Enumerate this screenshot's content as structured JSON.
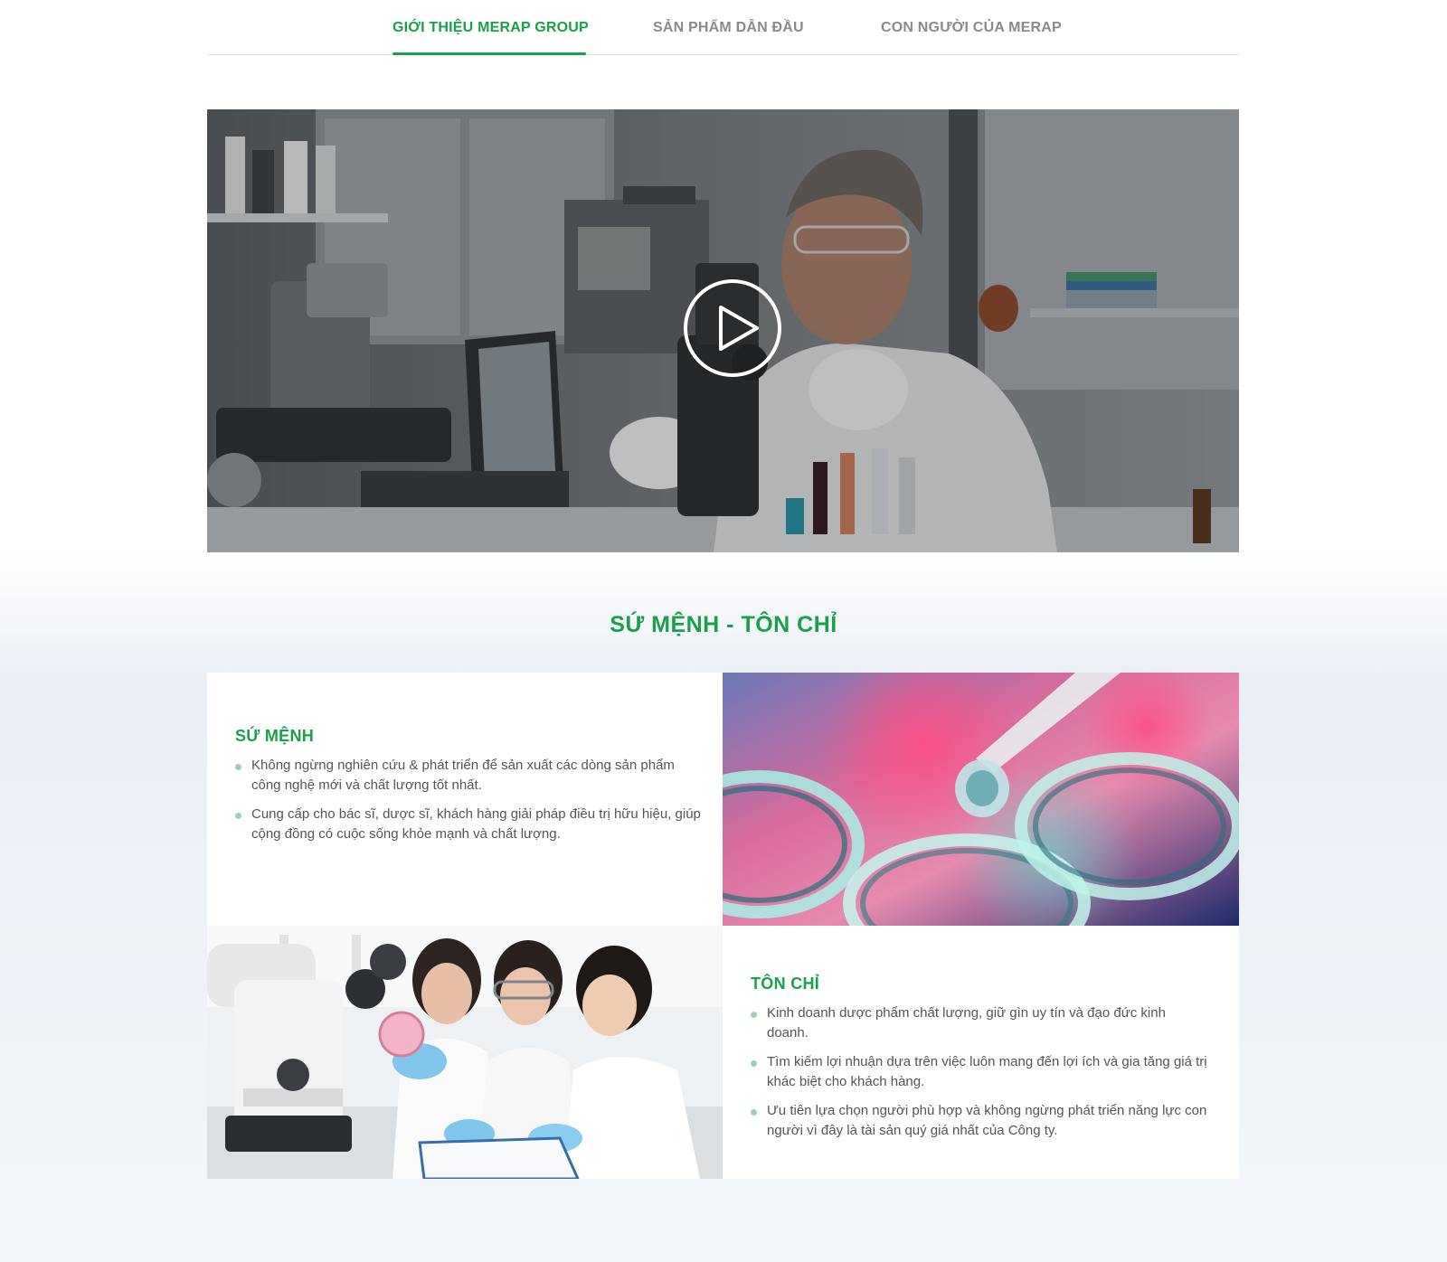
{
  "tabs": [
    {
      "label": "GIỚI THIỆU MERAP GROUP",
      "active": true
    },
    {
      "label": "SẢN PHẨM DẪN ĐẦU",
      "active": false
    },
    {
      "label": "CON NGƯỜI CỦA MERAP",
      "active": false
    }
  ],
  "video": {
    "play_icon": "play-circle-icon"
  },
  "section": {
    "title": "SỨ MỆNH - TÔN CHỈ"
  },
  "mission": {
    "title": "SỨ MỆNH",
    "items": [
      "Không ngừng nghiên cứu & phát triển để sản xuất các dòng sản phẩm công nghệ mới và chất lượng tốt nhất.",
      "Cung cấp cho bác sĩ, dược sĩ, khách hàng giải pháp điều trị hữu hiệu, giúp cộng đồng có cuộc sống khỏe mạnh và chất lượng."
    ]
  },
  "principles": {
    "title": "TÔN CHỈ",
    "items": [
      "Kinh doanh dược phẩm chất lượng, giữ gìn uy tín và đạo đức kinh doanh.",
      "Tìm kiếm lợi nhuận dựa trên việc luôn mang đến lợi ích và gia tăng giá trị khác biệt cho khách hàng.",
      "Ưu tiên lựa chọn người phù hợp và không ngừng phát triển năng lực con người vì đây là tài sản quý giá nhất của Công ty."
    ]
  },
  "colors": {
    "brand_green": "#1aa04a",
    "tab_inactive": "#8a8a8a",
    "body_text": "#555555",
    "bullet": "#9ed2ad"
  }
}
